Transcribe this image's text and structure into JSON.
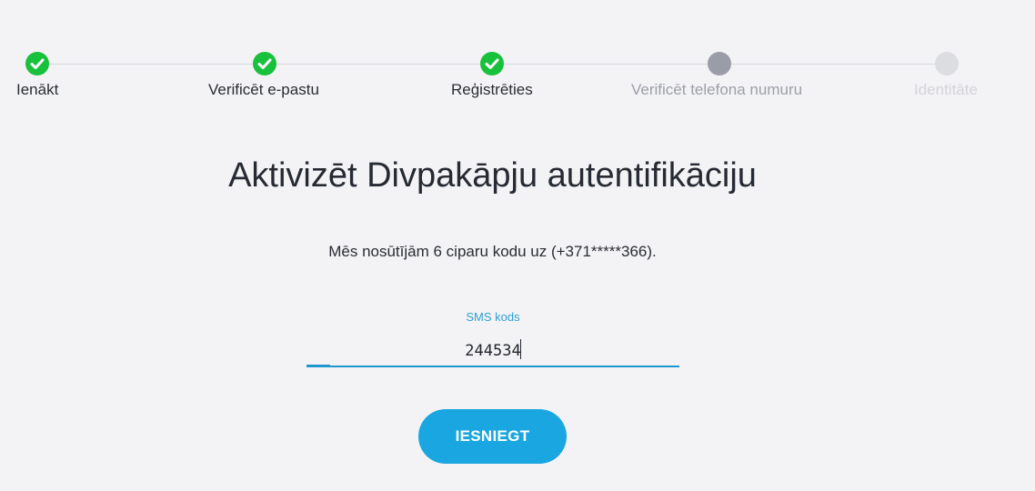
{
  "stepper": {
    "steps": [
      {
        "label": "Ienākt",
        "status": "done"
      },
      {
        "label": "Verificēt e-pastu",
        "status": "done"
      },
      {
        "label": "Reģistrēties",
        "status": "done"
      },
      {
        "label": "Verificēt telefona numuru",
        "status": "current"
      },
      {
        "label": "Identitāte",
        "status": "upcoming"
      }
    ]
  },
  "main": {
    "title": "Aktivizēt Divpakāpju autentifikāciju",
    "info": "Mēs nosūtījām 6 ciparu kodu uz (+371*****366).",
    "sms_field": {
      "label": "SMS kods",
      "value": "244534"
    },
    "submit_label": "IESNIEGT"
  },
  "colors": {
    "background": "#f3f3f5",
    "step_done": "#18c13b",
    "step_current": "#9a9da6",
    "step_upcoming": "#dcdde1",
    "accent": "#1aa6e0"
  },
  "icons": {
    "step_done": "check-icon"
  }
}
